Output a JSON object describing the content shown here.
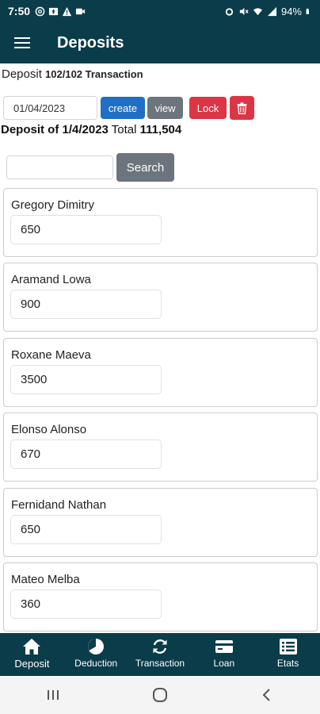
{
  "status_bar": {
    "time": "7:50",
    "battery": "94%"
  },
  "app_bar": {
    "title": "Deposits"
  },
  "summary": {
    "prefix": "Deposit",
    "count": "102/102 Transaction"
  },
  "date_row": {
    "date_value": "01/04/2023",
    "create_label": "create",
    "view_label": "view",
    "lock_label": "Lock"
  },
  "total": {
    "prefix": "Deposit of 1/4/2023",
    "total_label": "Total",
    "total_value": "111,504"
  },
  "search": {
    "value": "",
    "button_label": "Search"
  },
  "deposits": [
    {
      "name": "Gregory Dimitry",
      "amount": "650"
    },
    {
      "name": "Aramand Lowa",
      "amount": "900"
    },
    {
      "name": "Roxane Maeva",
      "amount": "3500"
    },
    {
      "name": "Elonso Alonso",
      "amount": "670"
    },
    {
      "name": "Fernidand Nathan",
      "amount": "650"
    },
    {
      "name": "Mateo Melba",
      "amount": "360"
    }
  ],
  "bottom_nav": [
    {
      "label": "Deposit",
      "icon": "home-icon"
    },
    {
      "label": "Deduction",
      "icon": "pie-chart-icon"
    },
    {
      "label": "Transaction",
      "icon": "sync-icon"
    },
    {
      "label": "Loan",
      "icon": "credit-card-icon"
    },
    {
      "label": "Etats",
      "icon": "list-icon"
    }
  ],
  "colors": {
    "primary": "#0b3c49",
    "create": "#1f6fc5",
    "secondary": "#6c757d",
    "danger": "#dc3545"
  }
}
